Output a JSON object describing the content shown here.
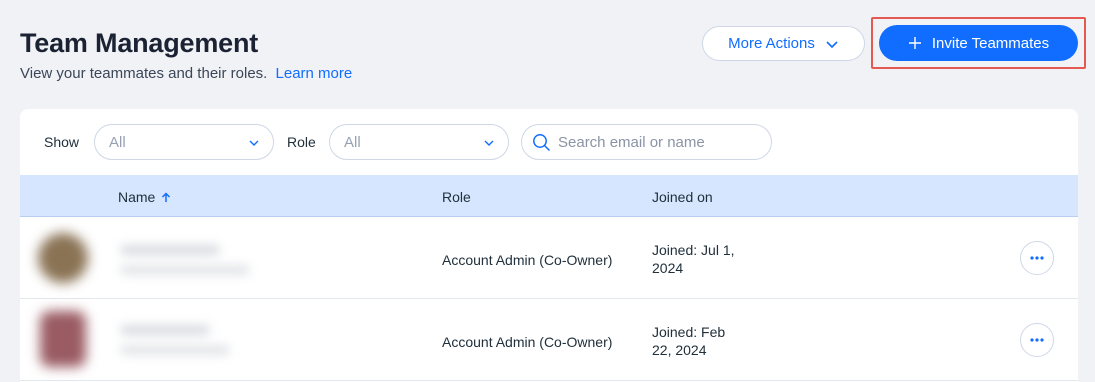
{
  "header": {
    "title": "Team Management",
    "subtitle": "View your teammates and their roles.",
    "learn_more": "Learn more",
    "more_actions_label": "More Actions",
    "invite_label": "Invite Teammates"
  },
  "filters": {
    "show_label": "Show",
    "show_value": "All",
    "role_label": "Role",
    "role_value": "All",
    "search_placeholder": "Search email or name"
  },
  "table": {
    "columns": [
      "Name",
      "Role",
      "Joined on"
    ],
    "rows": [
      {
        "role": "Account Admin (Co-Owner)",
        "joined_line1": "Joined: Jul 1,",
        "joined_line2": "2024"
      },
      {
        "role": "Account Admin (Co-Owner)",
        "joined_line1": "Joined: Feb",
        "joined_line2": "22, 2024"
      }
    ]
  },
  "colors": {
    "accent": "#116dff",
    "highlight": "#e45a52",
    "header_row": "#d6e6fe",
    "background": "#f0f2f6"
  },
  "icons": {
    "more_actions": "chevron-down-icon",
    "invite": "plus-icon",
    "search": "search-icon",
    "sort": "arrow-up-icon",
    "row_menu": "more-horizontal-icon"
  }
}
